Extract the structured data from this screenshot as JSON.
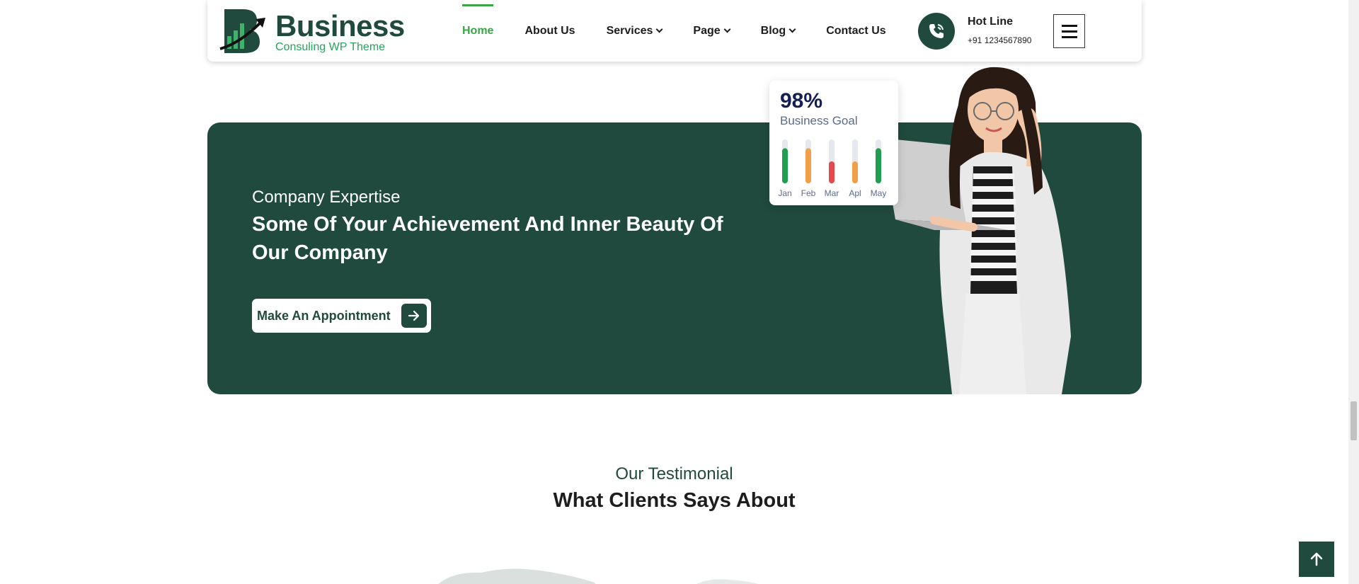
{
  "header": {
    "logo_word": "Business",
    "logo_tagline": "Consuling WP Theme",
    "nav": [
      {
        "label": "Home",
        "active": true,
        "dropdown": false
      },
      {
        "label": "About Us",
        "active": false,
        "dropdown": false
      },
      {
        "label": "Services",
        "active": false,
        "dropdown": true
      },
      {
        "label": "Page",
        "active": false,
        "dropdown": true
      },
      {
        "label": "Blog",
        "active": false,
        "dropdown": true
      },
      {
        "label": "Contact Us",
        "active": false,
        "dropdown": false
      }
    ],
    "hotline_title": "Hot Line",
    "hotline_number": "+91 1234567890",
    "menu_icon": "hamburger-icon"
  },
  "banner": {
    "subtitle": "Company Expertise",
    "title": "Some Of Your Achievement And Inner Beauty Of Our Company",
    "cta_label": "Make An Appointment",
    "cta_icon": "arrow-right-icon"
  },
  "stat_card": {
    "value": "98%",
    "label": "Business Goal",
    "months": [
      {
        "label": "Jan",
        "level": 0.8,
        "color": "#1f9e4f"
      },
      {
        "label": "Feb",
        "level": 0.8,
        "color": "#f0a04b"
      },
      {
        "label": "Mar",
        "level": 0.5,
        "color": "#e5484d"
      },
      {
        "label": "Apl",
        "level": 0.5,
        "color": "#f0a04b"
      },
      {
        "label": "May",
        "level": 0.8,
        "color": "#1f9e4f"
      }
    ]
  },
  "testimonial": {
    "subtitle": "Our Testimonial",
    "title": "What Clients Says About"
  },
  "back_to_top_icon": "arrow-up-icon",
  "colors": {
    "brand_dark": "#1f4a3d",
    "brand_green": "#3aa545"
  }
}
